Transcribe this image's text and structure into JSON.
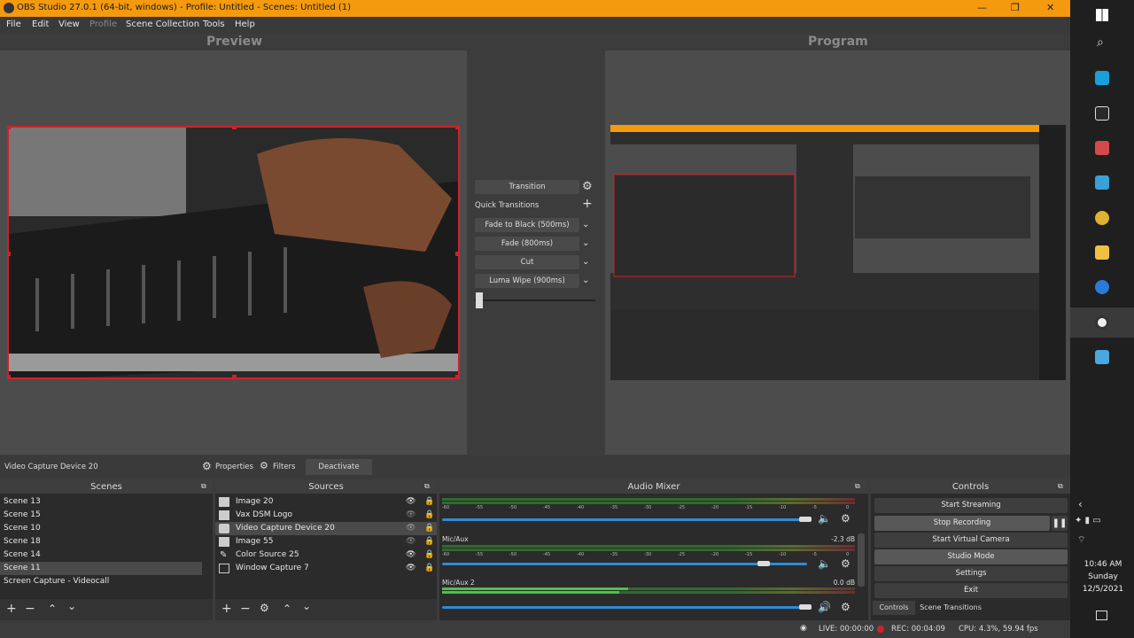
{
  "window": {
    "title": "OBS Studio 27.0.1 (64-bit, windows) - Profile: Untitled - Scenes: Untitled (1)",
    "minimize": "—",
    "maximize": "❐",
    "close": "✕"
  },
  "menu": [
    "File",
    "Edit",
    "View",
    "Profile",
    "Scene Collection",
    "Tools",
    "Help"
  ],
  "labels": {
    "preview": "Preview",
    "program": "Program"
  },
  "transition": {
    "button": "Transition",
    "quick": "Quick Transitions",
    "items": [
      "Fade to Black (500ms)",
      "Fade (800ms)",
      "Cut",
      "Luma Wipe (900ms)"
    ]
  },
  "source_toolbar": {
    "name": "Video Capture Device 20",
    "properties": "Properties",
    "filters": "Filters",
    "deactivate": "Deactivate"
  },
  "scenes": {
    "title": "Scenes",
    "items": [
      "Scene 13",
      "Scene 15",
      "Scene 10",
      "Scene 18",
      "Scene 14",
      "Scene 11",
      "Screen Capture - Videocall"
    ],
    "selected": 5
  },
  "sources": {
    "title": "Sources",
    "items": [
      "Image 20",
      "Vax DSM Logo",
      "Video Capture Device 20",
      "Image 55",
      "Color Source 25",
      "Window Capture 7"
    ],
    "selected": 2
  },
  "mixer": {
    "title": "Audio Mixer",
    "ticks": [
      "-60",
      "-55",
      "-50",
      "-45",
      "-40",
      "-35",
      "-30",
      "-25",
      "-20",
      "-15",
      "-10",
      "-5",
      "0"
    ],
    "channels": [
      {
        "name": "",
        "db": "",
        "muted": true,
        "level": 0.97
      },
      {
        "name": "Mic/Aux",
        "db": "-2.3 dB",
        "muted": true,
        "level": 0.78
      },
      {
        "name": "Mic/Aux 2",
        "db": "0.0 dB",
        "muted": false,
        "level": 0.97
      }
    ]
  },
  "controls": {
    "title": "Controls",
    "buttons": [
      "Start Streaming",
      "Stop Recording",
      "Start Virtual Camera",
      "Studio Mode",
      "Settings",
      "Exit"
    ],
    "tabs": [
      "Controls",
      "Scene Transitions"
    ]
  },
  "status": {
    "live": "LIVE: 00:00:00",
    "rec": "REC: 00:04:09",
    "cpu": "CPU: 4.3%, 59.94 fps"
  },
  "taskbar": {
    "time": "10:46 AM",
    "day": "Sunday",
    "date": "12/5/2021"
  },
  "colors": {
    "accent": "#f39a0e",
    "selection": "#d2202a"
  }
}
